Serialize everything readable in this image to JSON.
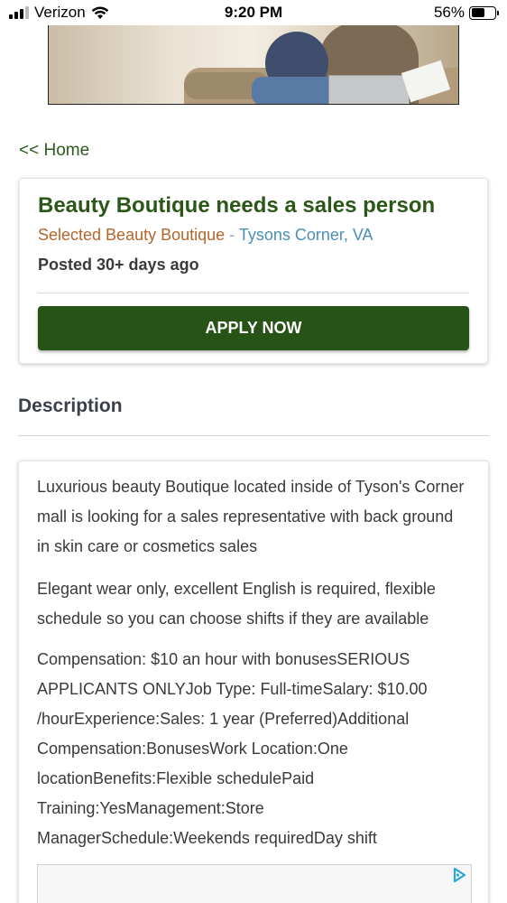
{
  "status_bar": {
    "carrier": "Verizon",
    "time": "9:20 PM",
    "battery_text": "56%",
    "battery_level": 0.56
  },
  "nav": {
    "home_link": "<< Home"
  },
  "job": {
    "title": "Beauty Boutique needs a sales person",
    "company": "Selected Beauty Boutique",
    "separator": " - ",
    "location": "Tysons Corner, VA",
    "posted": "Posted 30+ days ago",
    "apply_label": "APPLY NOW"
  },
  "description": {
    "heading": "Description",
    "paragraphs": [
      "Luxurious beauty Boutique located inside of Tyson's Corner mall is looking for a sales representative with back ground in skin care or cosmetics sales",
      "Elegant wear only, excellent English is required, flexible schedule so you can choose shifts if they are available",
      "Compensation: $10 an hour with bonusesSERIOUS APPLICANTS ONLYJob Type: Full-timeSalary: $10.00 /hourExperience:Sales: 1 year (Preferred)Additional Compensation:BonusesWork Location:One locationBenefits:Flexible schedulePaid Training:YesManagement:Store ManagerSchedule:Weekends requiredDay shift"
    ]
  },
  "colors": {
    "brand_green": "#275416",
    "title_green": "#2b5718",
    "company_orange": "#b5652a",
    "location_blue": "#4c8fb4"
  }
}
